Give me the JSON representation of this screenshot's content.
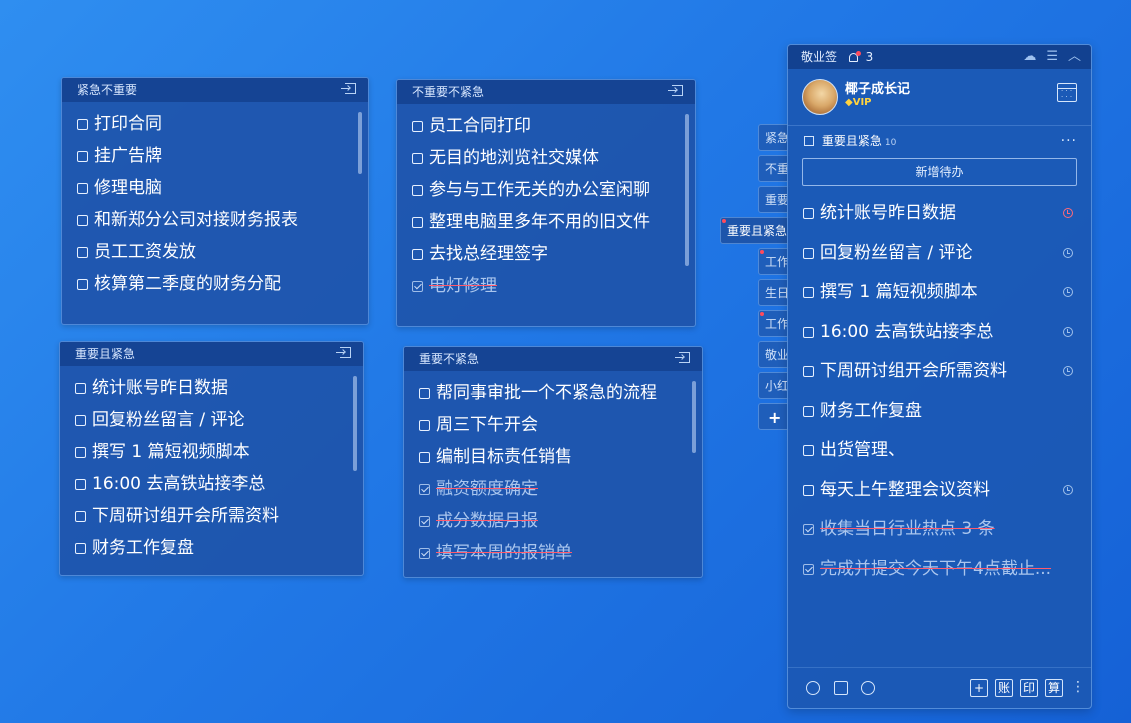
{
  "notes": [
    {
      "title": "紧急不重要",
      "items": [
        {
          "text": "打印合同",
          "done": false
        },
        {
          "text": "挂广告牌",
          "done": false
        },
        {
          "text": "修理电脑",
          "done": false
        },
        {
          "text": "和新郑分公司对接财务报表",
          "done": false
        },
        {
          "text": "员工工资发放",
          "done": false
        },
        {
          "text": "核算第二季度的财务分配",
          "done": false
        }
      ]
    },
    {
      "title": "不重要不紧急",
      "items": [
        {
          "text": "员工合同打印",
          "done": false
        },
        {
          "text": "无目的地浏览社交媒体",
          "done": false
        },
        {
          "text": "参与与工作无关的办公室闲聊",
          "done": false
        },
        {
          "text": "整理电脑里多年不用的旧文件",
          "done": false
        },
        {
          "text": "去找总经理签字",
          "done": false
        },
        {
          "text": "电灯修理",
          "done": true
        }
      ]
    },
    {
      "title": "重要且紧急",
      "items": [
        {
          "text": "统计账号昨日数据",
          "done": false
        },
        {
          "text": "回复粉丝留言 / 评论",
          "done": false
        },
        {
          "text": "撰写 1 篇短视频脚本",
          "done": false
        },
        {
          "text": "16:00 去高铁站接李总",
          "done": false
        },
        {
          "text": "下周研讨组开会所需资料",
          "done": false
        },
        {
          "text": "财务工作复盘",
          "done": false
        }
      ]
    },
    {
      "title": "重要不紧急",
      "items": [
        {
          "text": "帮同事审批一个不紧急的流程",
          "done": false
        },
        {
          "text": "周三下午开会",
          "done": false
        },
        {
          "text": "编制目标责任销售",
          "done": false
        },
        {
          "text": "融资额度确定",
          "done": true
        },
        {
          "text": "成分数据月报",
          "done": true
        },
        {
          "text": " 填写本周的报销单",
          "done": true
        }
      ]
    }
  ],
  "tabs": [
    "紧急",
    "不重",
    "重要",
    "重要且紧急",
    "工作",
    "生日",
    "工作",
    "敬业",
    "小红"
  ],
  "tab_add": "+",
  "panel": {
    "app_name": "敬业签",
    "notify_count": "3",
    "user_name": "椰子成长记",
    "vip_label": "VIP",
    "section_title": "重要且紧急",
    "section_count": "10",
    "more": "···",
    "add_button": "新增待办",
    "items": [
      {
        "text": "统计账号昨日数据",
        "done": false,
        "clock": "red"
      },
      {
        "text": "回复粉丝留言 / 评论",
        "done": false,
        "clock": "normal"
      },
      {
        "text": "撰写 1 篇短视频脚本",
        "done": false,
        "clock": "normal"
      },
      {
        "text": "16:00 去高铁站接李总",
        "done": false,
        "clock": "normal"
      },
      {
        "text": "下周研讨组开会所需资料",
        "done": false,
        "clock": "normal"
      },
      {
        "text": "财务工作复盘",
        "done": false,
        "clock": "none"
      },
      {
        "text": "出货管理、",
        "done": false,
        "clock": "none"
      },
      {
        "text": "每天上午整理会议资料",
        "done": false,
        "clock": "normal"
      },
      {
        "text": "收集当日行业热点 3 条",
        "done": true,
        "clock": "none"
      },
      {
        "text": "完成并提交今天下午4点截止...",
        "done": true,
        "clock": "none"
      }
    ],
    "bottom_buttons": [
      "+",
      "账",
      "印",
      "算"
    ],
    "bottom_more": "⋮"
  },
  "colors": {
    "accent_red": "#ff4b5c",
    "vip_gold": "#ffd23f"
  }
}
